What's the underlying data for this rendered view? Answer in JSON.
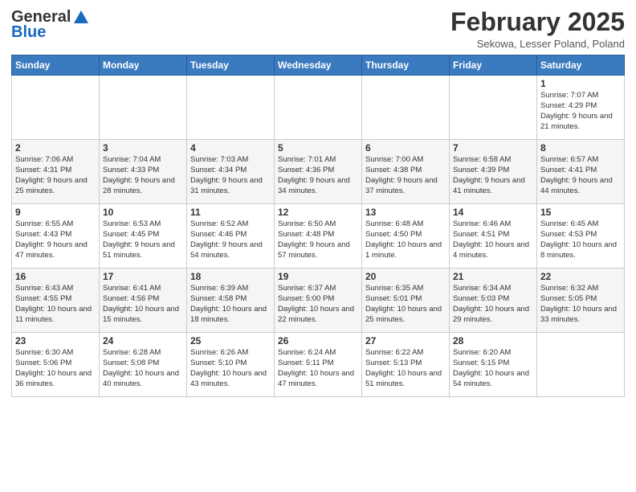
{
  "header": {
    "logo_general": "General",
    "logo_blue": "Blue",
    "month_title": "February 2025",
    "location": "Sekowa, Lesser Poland, Poland"
  },
  "days_of_week": [
    "Sunday",
    "Monday",
    "Tuesday",
    "Wednesday",
    "Thursday",
    "Friday",
    "Saturday"
  ],
  "weeks": [
    [
      {
        "day": "",
        "info": ""
      },
      {
        "day": "",
        "info": ""
      },
      {
        "day": "",
        "info": ""
      },
      {
        "day": "",
        "info": ""
      },
      {
        "day": "",
        "info": ""
      },
      {
        "day": "",
        "info": ""
      },
      {
        "day": "1",
        "info": "Sunrise: 7:07 AM\nSunset: 4:29 PM\nDaylight: 9 hours and 21 minutes."
      }
    ],
    [
      {
        "day": "2",
        "info": "Sunrise: 7:06 AM\nSunset: 4:31 PM\nDaylight: 9 hours and 25 minutes."
      },
      {
        "day": "3",
        "info": "Sunrise: 7:04 AM\nSunset: 4:33 PM\nDaylight: 9 hours and 28 minutes."
      },
      {
        "day": "4",
        "info": "Sunrise: 7:03 AM\nSunset: 4:34 PM\nDaylight: 9 hours and 31 minutes."
      },
      {
        "day": "5",
        "info": "Sunrise: 7:01 AM\nSunset: 4:36 PM\nDaylight: 9 hours and 34 minutes."
      },
      {
        "day": "6",
        "info": "Sunrise: 7:00 AM\nSunset: 4:38 PM\nDaylight: 9 hours and 37 minutes."
      },
      {
        "day": "7",
        "info": "Sunrise: 6:58 AM\nSunset: 4:39 PM\nDaylight: 9 hours and 41 minutes."
      },
      {
        "day": "8",
        "info": "Sunrise: 6:57 AM\nSunset: 4:41 PM\nDaylight: 9 hours and 44 minutes."
      }
    ],
    [
      {
        "day": "9",
        "info": "Sunrise: 6:55 AM\nSunset: 4:43 PM\nDaylight: 9 hours and 47 minutes."
      },
      {
        "day": "10",
        "info": "Sunrise: 6:53 AM\nSunset: 4:45 PM\nDaylight: 9 hours and 51 minutes."
      },
      {
        "day": "11",
        "info": "Sunrise: 6:52 AM\nSunset: 4:46 PM\nDaylight: 9 hours and 54 minutes."
      },
      {
        "day": "12",
        "info": "Sunrise: 6:50 AM\nSunset: 4:48 PM\nDaylight: 9 hours and 57 minutes."
      },
      {
        "day": "13",
        "info": "Sunrise: 6:48 AM\nSunset: 4:50 PM\nDaylight: 10 hours and 1 minute."
      },
      {
        "day": "14",
        "info": "Sunrise: 6:46 AM\nSunset: 4:51 PM\nDaylight: 10 hours and 4 minutes."
      },
      {
        "day": "15",
        "info": "Sunrise: 6:45 AM\nSunset: 4:53 PM\nDaylight: 10 hours and 8 minutes."
      }
    ],
    [
      {
        "day": "16",
        "info": "Sunrise: 6:43 AM\nSunset: 4:55 PM\nDaylight: 10 hours and 11 minutes."
      },
      {
        "day": "17",
        "info": "Sunrise: 6:41 AM\nSunset: 4:56 PM\nDaylight: 10 hours and 15 minutes."
      },
      {
        "day": "18",
        "info": "Sunrise: 6:39 AM\nSunset: 4:58 PM\nDaylight: 10 hours and 18 minutes."
      },
      {
        "day": "19",
        "info": "Sunrise: 6:37 AM\nSunset: 5:00 PM\nDaylight: 10 hours and 22 minutes."
      },
      {
        "day": "20",
        "info": "Sunrise: 6:35 AM\nSunset: 5:01 PM\nDaylight: 10 hours and 25 minutes."
      },
      {
        "day": "21",
        "info": "Sunrise: 6:34 AM\nSunset: 5:03 PM\nDaylight: 10 hours and 29 minutes."
      },
      {
        "day": "22",
        "info": "Sunrise: 6:32 AM\nSunset: 5:05 PM\nDaylight: 10 hours and 33 minutes."
      }
    ],
    [
      {
        "day": "23",
        "info": "Sunrise: 6:30 AM\nSunset: 5:06 PM\nDaylight: 10 hours and 36 minutes."
      },
      {
        "day": "24",
        "info": "Sunrise: 6:28 AM\nSunset: 5:08 PM\nDaylight: 10 hours and 40 minutes."
      },
      {
        "day": "25",
        "info": "Sunrise: 6:26 AM\nSunset: 5:10 PM\nDaylight: 10 hours and 43 minutes."
      },
      {
        "day": "26",
        "info": "Sunrise: 6:24 AM\nSunset: 5:11 PM\nDaylight: 10 hours and 47 minutes."
      },
      {
        "day": "27",
        "info": "Sunrise: 6:22 AM\nSunset: 5:13 PM\nDaylight: 10 hours and 51 minutes."
      },
      {
        "day": "28",
        "info": "Sunrise: 6:20 AM\nSunset: 5:15 PM\nDaylight: 10 hours and 54 minutes."
      },
      {
        "day": "",
        "info": ""
      }
    ]
  ]
}
